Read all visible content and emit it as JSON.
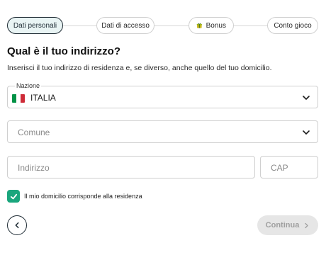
{
  "stepper": {
    "steps": [
      {
        "label": "Dati personali"
      },
      {
        "label": "Dati di accesso"
      },
      {
        "label": "Bonus"
      },
      {
        "label": "Conto gioco"
      }
    ]
  },
  "form": {
    "title": "Qual è il tuo indirizzo?",
    "subtitle": "Inserisci il tuo indirizzo di residenza e, se diverso, anche quello del tuo domicilio.",
    "nation": {
      "label": "Nazione",
      "value": "ITALIA",
      "flag_colors": [
        "#009246",
        "#ffffff",
        "#ce2b37"
      ]
    },
    "comune": {
      "placeholder": "Comune"
    },
    "indirizzo": {
      "placeholder": "Indirizzo"
    },
    "cap": {
      "placeholder": "CAP"
    },
    "domicile_checkbox": {
      "label": "Il mio domicilio corrisponde alla residenza",
      "checked": true
    }
  },
  "actions": {
    "continue_label": "Continua",
    "continue_enabled": false
  },
  "colors": {
    "accent": "#1aa67d",
    "dark": "#1d2a33",
    "active_step_bg": "#e9f4f4",
    "disabled_bg": "#e6e6e6"
  },
  "icons": [
    "chevron-down-icon",
    "check-icon",
    "chevron-left-icon",
    "chevron-right-icon",
    "bonus-icon",
    "italy-flag-icon"
  ]
}
